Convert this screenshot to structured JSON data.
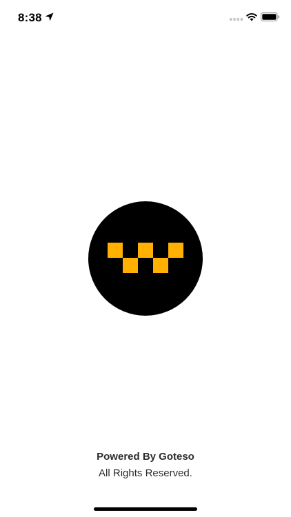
{
  "status_bar": {
    "time": "8:38",
    "icons": [
      "location-arrow-icon",
      "cellular-signal-icon",
      "wifi-icon",
      "battery-icon"
    ]
  },
  "logo": {
    "icon": "taxi-checker-logo",
    "background_color": "#000000",
    "accent_color": "#FFB000"
  },
  "footer": {
    "powered_by": "Powered By Goteso",
    "rights": "All Rights Reserved."
  }
}
